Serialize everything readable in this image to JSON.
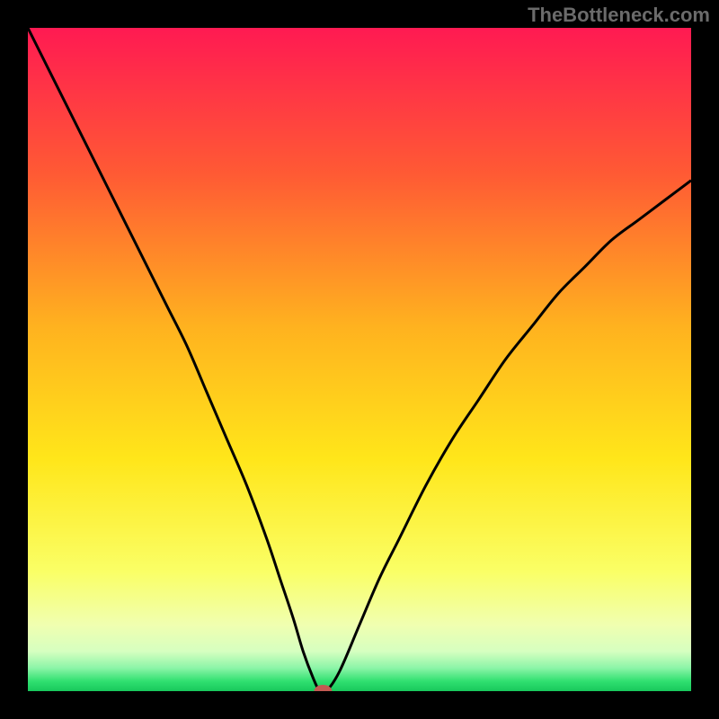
{
  "watermark": "TheBottleneck.com",
  "chart_data": {
    "type": "line",
    "title": "",
    "xlabel": "",
    "ylabel": "",
    "xlim": [
      0,
      100
    ],
    "ylim": [
      0,
      100
    ],
    "x": [
      0,
      3,
      6,
      9,
      12,
      15,
      18,
      21,
      24,
      27,
      30,
      33,
      36,
      38,
      40,
      41.5,
      43,
      44,
      45,
      47,
      50,
      53,
      56,
      60,
      64,
      68,
      72,
      76,
      80,
      84,
      88,
      92,
      96,
      100
    ],
    "y": [
      100,
      94,
      88,
      82,
      76,
      70,
      64,
      58,
      52,
      45,
      38,
      31,
      23,
      17,
      11,
      6,
      2,
      0,
      0,
      3,
      10,
      17,
      23,
      31,
      38,
      44,
      50,
      55,
      60,
      64,
      68,
      71,
      74,
      77
    ],
    "marker": {
      "x": 44.5,
      "y": 0
    },
    "gradient_stops": [
      {
        "offset": 0.0,
        "color": "#ff1a52"
      },
      {
        "offset": 0.22,
        "color": "#ff5a34"
      },
      {
        "offset": 0.45,
        "color": "#ffb21f"
      },
      {
        "offset": 0.65,
        "color": "#ffe61a"
      },
      {
        "offset": 0.82,
        "color": "#faff66"
      },
      {
        "offset": 0.9,
        "color": "#f0ffb0"
      },
      {
        "offset": 0.94,
        "color": "#d6ffc0"
      },
      {
        "offset": 0.965,
        "color": "#8cf5a8"
      },
      {
        "offset": 0.985,
        "color": "#30e070"
      },
      {
        "offset": 1.0,
        "color": "#18c85c"
      }
    ],
    "curve_color": "#000000",
    "marker_color": "#c45a52"
  }
}
